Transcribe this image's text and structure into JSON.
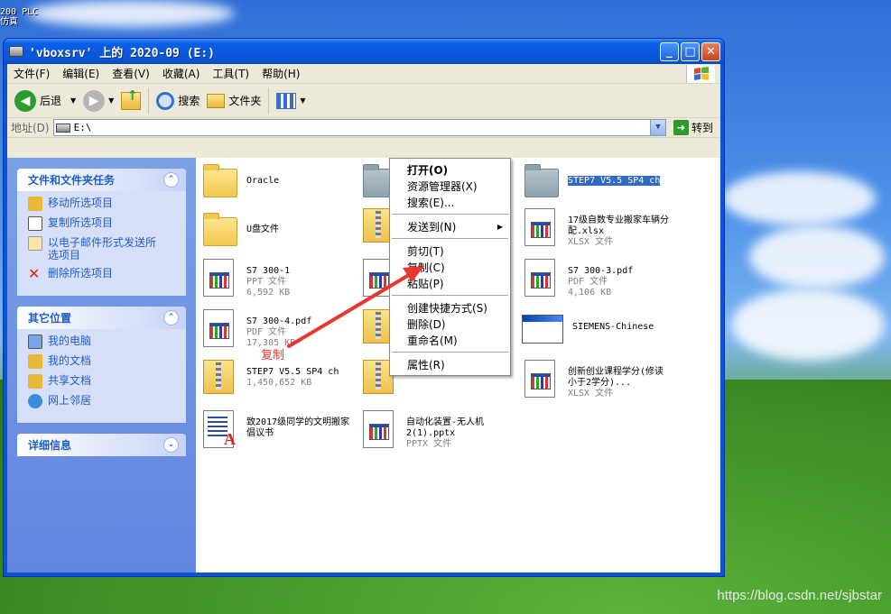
{
  "desktop": {
    "corner_lines": [
      "200 PLC",
      "仿真"
    ],
    "watermark": "https://blog.csdn.net/sjbstar"
  },
  "window": {
    "title": "'vboxsrv' 上的 2020-09 (E:)",
    "controls": {
      "minimize": "_",
      "maximize": "□",
      "close": "✕"
    }
  },
  "menubar": {
    "items": [
      "文件(F)",
      "编辑(E)",
      "查看(V)",
      "收藏(A)",
      "工具(T)",
      "帮助(H)"
    ]
  },
  "toolbar": {
    "back": "后退",
    "search": "搜索",
    "folders": "文件夹"
  },
  "address": {
    "label": "地址(D)",
    "value": "E:\\",
    "go": "转到"
  },
  "taskpane": {
    "file_tasks": {
      "title": "文件和文件夹任务",
      "items": [
        "移动所选项目",
        "复制所选项目",
        "以电子邮件形式发送所选项目",
        "删除所选项目"
      ]
    },
    "other_places": {
      "title": "其它位置",
      "items": [
        "我的电脑",
        "我的文档",
        "共享文档",
        "网上邻居"
      ]
    },
    "details": {
      "title": "详细信息"
    }
  },
  "files": [
    {
      "name": "Oracle",
      "line2": "",
      "line3": "",
      "icon": "folder"
    },
    {
      "name": "STEP7 V5.5 SP4 ch",
      "line2": "",
      "line3": "",
      "icon": "folder-grey",
      "selected": true
    },
    {
      "name": "U盘文件",
      "line2": "",
      "line3": "",
      "icon": "folder"
    },
    {
      "name": "17级自数专业搬家车辆分配.xlsx",
      "line2": "XLSX 文件",
      "line3": "",
      "icon": "doc"
    },
    {
      "name": "S7 300-1",
      "line2": "PPT 文件",
      "line3": "6,592 KB",
      "icon": "doc"
    },
    {
      "name": "S7 300-3.pdf",
      "line2": "PDF 文件",
      "line3": "4,106 KB",
      "icon": "doc"
    },
    {
      "name": "S7 300-4.pdf",
      "line2": "PDF 文件",
      "line3": "17,305 KB",
      "icon": "doc"
    },
    {
      "name": "SIEMENS-Chinese",
      "line2": "",
      "line3": "",
      "icon": "exe"
    },
    {
      "name": "STEP7 V5.5 SP4 ch",
      "line2": "",
      "line3": "1,450,652 KB",
      "icon": "zip"
    },
    {
      "name": "创新创业课程学分(修读小于2学分)...",
      "line2": "XLSX 文件",
      "line3": "",
      "icon": "doc"
    },
    {
      "name": "致2017级同学的文明搬家倡议书",
      "line2": "",
      "line3": "",
      "icon": "wordpad"
    },
    {
      "name": "自动化装置-无人机2(1).pptx",
      "line2": "PPTX 文件",
      "line3": "",
      "icon": "doc"
    }
  ],
  "context_menu": {
    "items": [
      "打开(O)",
      "资源管理器(X)",
      "搜索(E)...",
      "发送到(N)",
      "剪切(T)",
      "复制(C)",
      "粘贴(P)",
      "创建快捷方式(S)",
      "删除(D)",
      "重命名(M)",
      "属性(R)"
    ]
  },
  "annotation": {
    "label": "复制",
    "color": "#e8372f"
  }
}
